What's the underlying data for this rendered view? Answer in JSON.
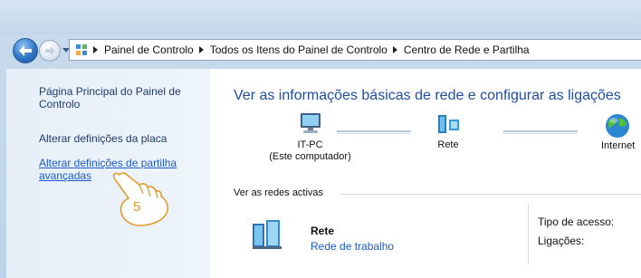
{
  "addressbar": {
    "crumbs": [
      "Painel de Controlo",
      "Todos os Itens do Painel de Controlo",
      "Centro de Rede e Partilha"
    ]
  },
  "sidebar": {
    "home_line1": "Página Principal do Painel de",
    "home_line2": "Controlo",
    "adapter_settings": "Alterar definições da placa",
    "advanced_line1": "Alterar definições de partilha",
    "advanced_line2": "avançadas"
  },
  "main": {
    "title": "Ver as informações básicas de rede e configurar as ligações",
    "map": {
      "computer_name": "IT-PC",
      "computer_sub": "(Este computador)",
      "network": "Rete",
      "internet": "Internet"
    },
    "active_networks_label": "Ver as redes activas",
    "active_network": {
      "name": "Rete",
      "type": "Rede de trabalho",
      "access_type_label": "Tipo de acesso:",
      "connections_label": "Ligações:"
    }
  },
  "annotation": {
    "step_number": "5",
    "color": "#e09a2d"
  },
  "icons": [
    "back-arrow-icon",
    "forward-arrow-icon",
    "control-panel-icon",
    "computer-icon",
    "network-icon",
    "globe-icon",
    "network-bench-icon",
    "pointing-hand-icon"
  ]
}
